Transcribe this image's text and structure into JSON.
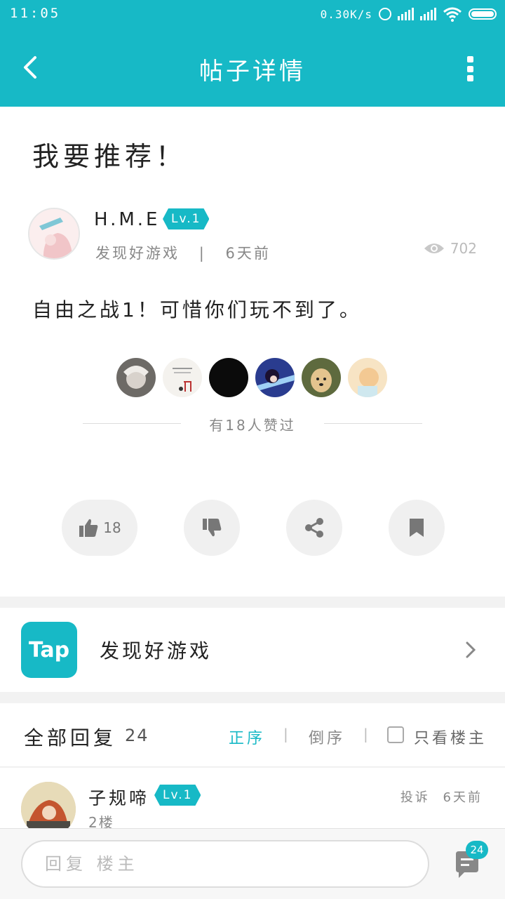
{
  "status_bar": {
    "time": "11:05",
    "net_speed": "0.30K/s"
  },
  "header": {
    "title": "帖子详情",
    "back_icon": "chevron-left-icon",
    "more_icon": "more-vertical-icon"
  },
  "post": {
    "title": "我要推荐！",
    "author": {
      "name": "H.M.E",
      "level": "Lv.1"
    },
    "meta": {
      "board": "发现好游戏",
      "separator": "|",
      "time": "6天前"
    },
    "views": "702",
    "content": "自由之战1！可惜你们玩不到了。",
    "likers_text": "有18人赞过",
    "actions": {
      "like_count": "18"
    }
  },
  "source": {
    "logo_text": "Tap",
    "name": "发现好游戏"
  },
  "replies": {
    "title": "全部回复",
    "count": "24",
    "sort_asc": "正序",
    "sort_desc": "倒序",
    "sep": "|",
    "only_op": "只看楼主",
    "items": [
      {
        "name": "子规啼",
        "level": "Lv.1",
        "floor": "2楼",
        "report": "投诉",
        "time": "6天前"
      }
    ]
  },
  "bottom_bar": {
    "placeholder": "回复  楼主",
    "comment_count": "24"
  },
  "colors": {
    "accent": "#17b9c6",
    "grey_text": "#888888"
  }
}
